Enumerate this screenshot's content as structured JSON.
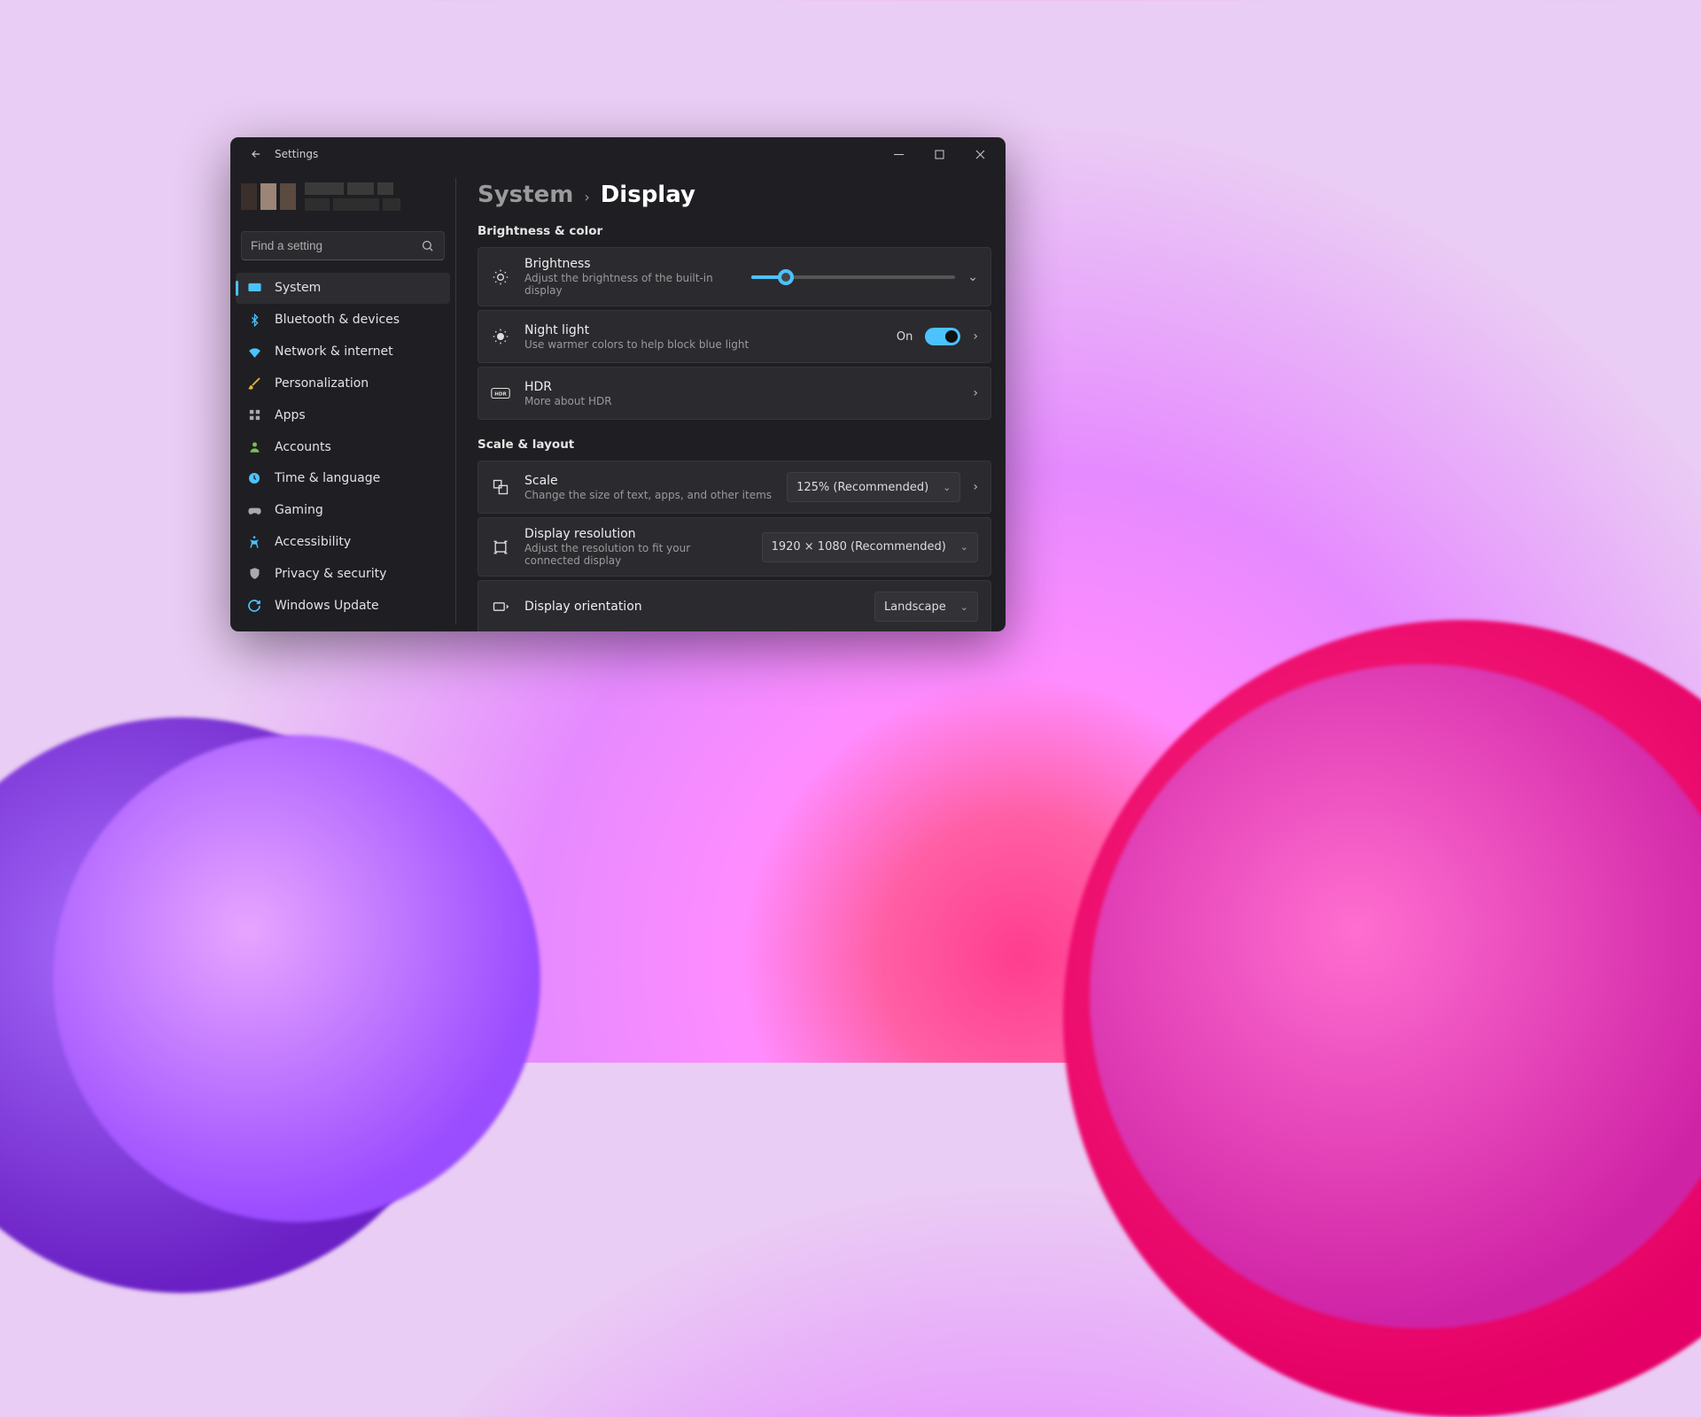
{
  "app": {
    "title": "Settings"
  },
  "search": {
    "placeholder": "Find a setting"
  },
  "sidebar": {
    "items": [
      {
        "label": "System"
      },
      {
        "label": "Bluetooth & devices"
      },
      {
        "label": "Network & internet"
      },
      {
        "label": "Personalization"
      },
      {
        "label": "Apps"
      },
      {
        "label": "Accounts"
      },
      {
        "label": "Time & language"
      },
      {
        "label": "Gaming"
      },
      {
        "label": "Accessibility"
      },
      {
        "label": "Privacy & security"
      },
      {
        "label": "Windows Update"
      }
    ]
  },
  "breadcrumb": {
    "parent": "System",
    "current": "Display"
  },
  "sections": {
    "brightness_color": {
      "title": "Brightness & color",
      "brightness": {
        "title": "Brightness",
        "sub": "Adjust the brightness of the built-in display",
        "value_pct": 17
      },
      "night_light": {
        "title": "Night light",
        "sub": "Use warmer colors to help block blue light",
        "state_label": "On",
        "on": true
      },
      "hdr": {
        "title": "HDR",
        "sub": "More about HDR"
      }
    },
    "scale_layout": {
      "title": "Scale & layout",
      "scale": {
        "title": "Scale",
        "sub": "Change the size of text, apps, and other items",
        "value": "125% (Recommended)"
      },
      "resolution": {
        "title": "Display resolution",
        "sub": "Adjust the resolution to fit your connected display",
        "value": "1920 × 1080 (Recommended)"
      },
      "orientation": {
        "title": "Display orientation",
        "value": "Landscape"
      }
    }
  }
}
